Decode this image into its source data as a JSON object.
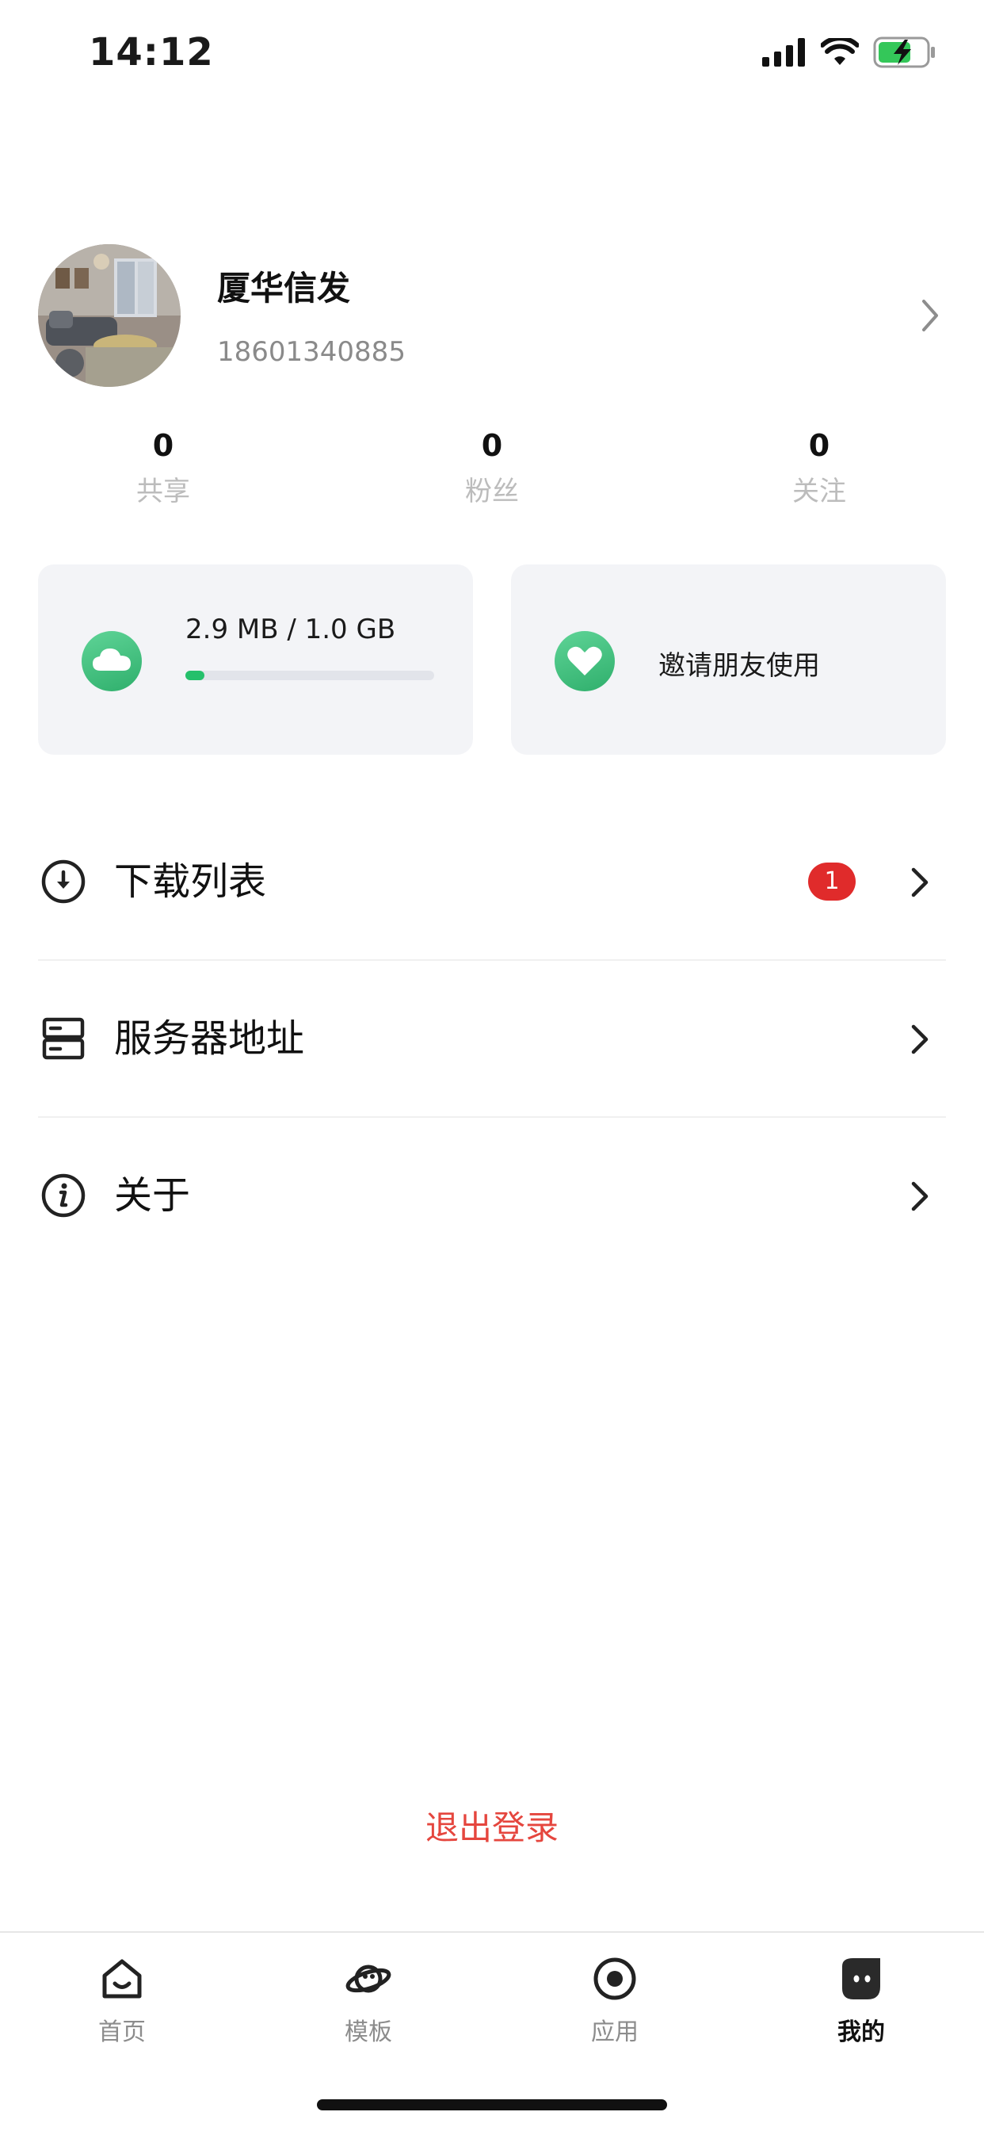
{
  "status_bar": {
    "time": "14:12",
    "icons": [
      "cellular-signal-icon",
      "wifi-icon",
      "battery-charging-icon"
    ],
    "battery_color": "#34c759"
  },
  "profile": {
    "name": "厦华信发",
    "phone": "18601340885",
    "avatar_icon": "living-room-photo"
  },
  "stats": [
    {
      "value": "0",
      "label": "共享"
    },
    {
      "value": "0",
      "label": "粉丝"
    },
    {
      "value": "0",
      "label": "关注"
    }
  ],
  "storage_card": {
    "icon": "cloud-icon",
    "text": "2.9 MB / 1.0 GB",
    "progress_fraction": 0.0028
  },
  "invite_card": {
    "icon": "heart-icon",
    "label": "邀请朋友使用"
  },
  "menu": [
    {
      "label": "下载列表",
      "icon": "download-icon",
      "badge": "1"
    },
    {
      "label": "服务器地址",
      "icon": "server-icon"
    },
    {
      "label": "关于",
      "icon": "info-icon"
    }
  ],
  "logout_label": "退出登录",
  "tabs": [
    {
      "label": "首页",
      "icon": "home-icon",
      "active": false
    },
    {
      "label": "模板",
      "icon": "planet-icon",
      "active": false
    },
    {
      "label": "应用",
      "icon": "target-icon",
      "active": false
    },
    {
      "label": "我的",
      "icon": "profile-face-icon",
      "active": true
    }
  ],
  "colors": {
    "accent_green": "#25c06b",
    "badge_red": "#e02b2b",
    "logout_red": "#e5463e"
  }
}
